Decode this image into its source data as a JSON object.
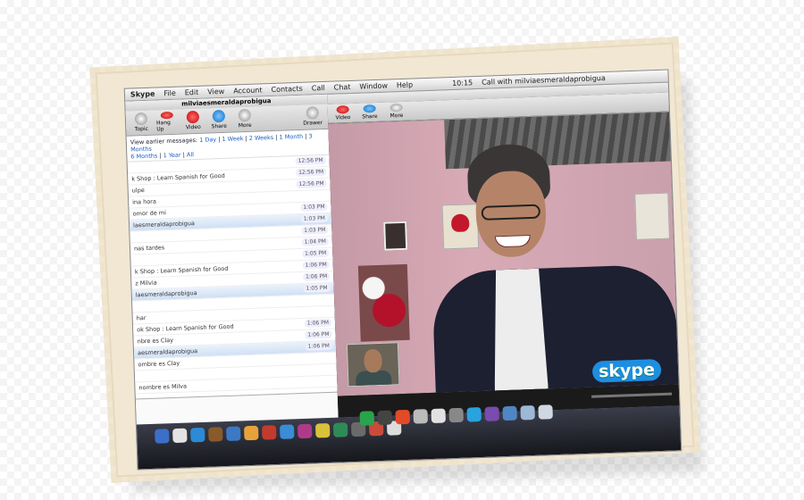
{
  "menubar": {
    "items": [
      "Skype",
      "File",
      "Edit",
      "View",
      "Account",
      "Contacts",
      "Call",
      "Chat",
      "Window",
      "Help"
    ],
    "clock": "10:15",
    "call_title": "Call with milviaesmeraldaprobigua"
  },
  "chat": {
    "contact": "milviaesmeraldaprobigua",
    "toolbar": [
      "Topic",
      "Hang Up",
      "Video",
      "Share",
      "More",
      "Drawer"
    ],
    "earlier_label": "View earlier messages:",
    "earlier_links": [
      "1 Day",
      "1 Week",
      "2 Weeks",
      "1 Month",
      "3 Months",
      "6 Months",
      "1 Year",
      "All"
    ],
    "messages": [
      {
        "text": "",
        "time": "12:56 PM",
        "highlight": false
      },
      {
        "text": "k Shop : Learn Spanish for Good",
        "time": "12:56 PM",
        "highlight": false
      },
      {
        "text": "ulpe",
        "time": "12:56 PM",
        "highlight": false
      },
      {
        "text": "ina hora",
        "time": "",
        "highlight": false
      },
      {
        "text": "omor de mi",
        "time": "1:03 PM",
        "highlight": false
      },
      {
        "text": "laesmeraldaprobigua",
        "time": "1:03 PM",
        "highlight": true
      },
      {
        "text": "",
        "time": "1:03 PM",
        "highlight": false
      },
      {
        "text": "nas tardes",
        "time": "1:04 PM",
        "highlight": false
      },
      {
        "text": "",
        "time": "1:05 PM",
        "highlight": false
      },
      {
        "text": "k Shop : Learn Spanish for Good",
        "time": "1:06 PM",
        "highlight": false
      },
      {
        "text": "z Milvia",
        "time": "1:06 PM",
        "highlight": false
      },
      {
        "text": "laesmeraldaprobigua",
        "time": "1:05 PM",
        "highlight": true
      },
      {
        "text": "",
        "time": "",
        "highlight": false
      },
      {
        "text": "har",
        "time": "",
        "highlight": false
      },
      {
        "text": "ok Shop : Learn Spanish for Good",
        "time": "1:06 PM",
        "highlight": false
      },
      {
        "text": "nbre es Clay",
        "time": "1:06 PM",
        "highlight": false
      },
      {
        "text": "aesmeraldaprobigua",
        "time": "1:06 PM",
        "highlight": true
      },
      {
        "text": "ombre es Clay",
        "time": "",
        "highlight": false
      },
      {
        "text": "",
        "time": "",
        "highlight": false
      },
      {
        "text": "nombre es Milva",
        "time": "",
        "highlight": false
      }
    ]
  },
  "video": {
    "toolbar": [
      "Video",
      "Share",
      "More"
    ],
    "logo": "skype"
  },
  "colors": {
    "accent": "#1e8ee0",
    "hangup": "#c40000"
  }
}
